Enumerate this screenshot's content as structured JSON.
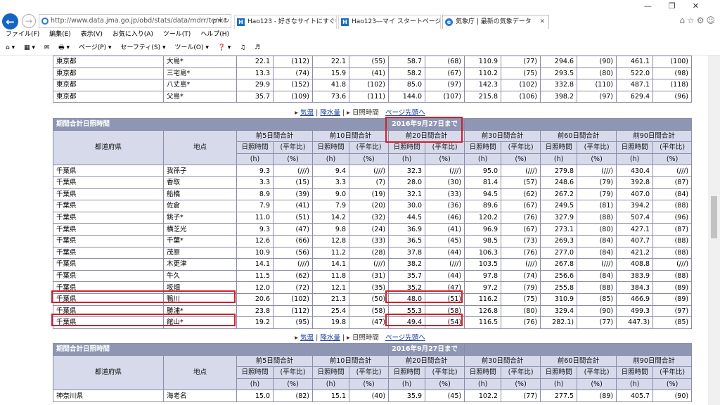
{
  "browser": {
    "url": "http://www.data.jma.go.jp/obd/stats/data/mdrr/tenkc",
    "addr_tools": "ρ ▾ ↻",
    "tabs": [
      {
        "label": "Hao123 - 好きなサイトにすぐ行ける",
        "icon": "H"
      },
      {
        "label": "Hao123―マイ スタートページ",
        "icon": "H"
      },
      {
        "label": "気象庁 | 最新の気象データ",
        "icon": "e"
      }
    ],
    "window_controls": "—❐✕",
    "right_icons": "⌂☆⚙☺",
    "menu": [
      "ファイル(F)",
      "編集(E)",
      "表示(V)",
      "お気に入り(A)",
      "ツール(T)",
      "ヘルプ(H)"
    ],
    "commands": [
      "⌂ ▾",
      "▦ ▾",
      "✉",
      "🖶 ▾",
      "ページ(P) ▾",
      "セーフティ(S) ▾",
      "ツール(O) ▾",
      "❓ ▾",
      "♫",
      "♬"
    ]
  },
  "page": {
    "links": {
      "items": [
        "気温",
        "降水量",
        "日照時間",
        "ページ先頭へ"
      ],
      "sep": "|"
    },
    "top_rows": [
      [
        "東京都",
        "大島*",
        "22.1",
        "(112)",
        "22.1",
        "(55)",
        "58.7",
        "(68)",
        "110.9",
        "(77)",
        "294.6",
        "(90)",
        "461.1",
        "(100)"
      ],
      [
        "東京都",
        "三宅島*",
        "13.3",
        "(74)",
        "15.9",
        "(41)",
        "58.2",
        "(67)",
        "110.2",
        "(75)",
        "293.5",
        "(80)",
        "522.0",
        "(98)"
      ],
      [
        "東京都",
        "八丈島*",
        "29.9",
        "(152)",
        "41.8",
        "(102)",
        "85.0",
        "(97)",
        "142.3",
        "(102)",
        "332.8",
        "(110)",
        "487.1",
        "(118)"
      ],
      [
        "東京都",
        "父島*",
        "35.7",
        "(109)",
        "73.6",
        "(111)",
        "144.0",
        "(107)",
        "215.8",
        "(106)",
        "398.2",
        "(97)",
        "629.4",
        "(96)"
      ]
    ],
    "section_title": "期間合計日照時間",
    "date_label": "2016年9月27日まで",
    "col_pref": "都道府県",
    "col_point": "地点",
    "periods": [
      "前5日間合計",
      "前10日間合計",
      "前20日間合計",
      "前30日間合計",
      "前60日間合計",
      "前90日間合計"
    ],
    "sub_hours": "日照時間",
    "sub_ratio": "(平年比)",
    "unit_hours": "(h)",
    "unit_ratio": "(%)",
    "chiba_rows": [
      [
        "千葉県",
        "我孫子",
        "9.3",
        "(///)",
        "9.4",
        "(///)",
        "32.3",
        "(///)",
        "95.0",
        "(///)",
        "279.8",
        "(///)",
        "430.4",
        "(///)"
      ],
      [
        "千葉県",
        "香取",
        "3.3",
        "(15)",
        "3.3",
        "(7)",
        "28.0",
        "(30)",
        "81.4",
        "(57)",
        "248.6",
        "(79)",
        "392.8",
        "(87)"
      ],
      [
        "千葉県",
        "船橋",
        "8.9",
        "(39)",
        "9.0",
        "(19)",
        "32.1",
        "(33)",
        "94.5",
        "(62)",
        "267.2",
        "(79)",
        "407.0",
        "(84)"
      ],
      [
        "千葉県",
        "佐倉",
        "7.9",
        "(41)",
        "7.9",
        "(20)",
        "30.0",
        "(36)",
        "89.6",
        "(67)",
        "249.5",
        "(81)",
        "394.2",
        "(88)"
      ],
      [
        "千葉県",
        "銚子*",
        "11.0",
        "(51)",
        "14.2",
        "(32)",
        "44.5",
        "(46)",
        "120.2",
        "(76)",
        "327.9",
        "(88)",
        "507.4",
        "(96)"
      ],
      [
        "千葉県",
        "横芝光",
        "9.3",
        "(47)",
        "9.8",
        "(24)",
        "36.9",
        "(41)",
        "96.9",
        "(67)",
        "273.1",
        "(80)",
        "427.1",
        "(87)"
      ],
      [
        "千葉県",
        "千葉*",
        "12.6",
        "(66)",
        "12.8",
        "(33)",
        "36.5",
        "(45)",
        "98.5",
        "(73)",
        "269.3",
        "(84)",
        "407.7",
        "(88)"
      ],
      [
        "千葉県",
        "茂原",
        "10.9",
        "(56)",
        "11.2",
        "(28)",
        "37.8",
        "(44)",
        "106.3",
        "(76)",
        "277.0",
        "(84)",
        "421.2",
        "(88)"
      ],
      [
        "千葉県",
        "木更津",
        "14.1",
        "(///)",
        "14.1",
        "(///)",
        "38.2",
        "(///)",
        "103.5",
        "(///)",
        "267.8",
        "(///)",
        "408.8",
        "(///)"
      ],
      [
        "千葉県",
        "牛久",
        "11.5",
        "(62)",
        "11.8",
        "(31)",
        "35.7",
        "(44)",
        "97.8",
        "(74)",
        "256.6",
        "(84)",
        "383.9",
        "(88)"
      ],
      [
        "千葉県",
        "坂畑",
        "12.0",
        "(72)",
        "12.1",
        "(35)",
        "35.2",
        "(47)",
        "97.2",
        "(79)",
        "255.8",
        "(88)",
        "384.3",
        "(89)"
      ],
      [
        "千葉県",
        "鴨川",
        "20.6",
        "(102)",
        "21.3",
        "(50)",
        "48.0",
        "(51)",
        "116.2",
        "(75)",
        "310.9",
        "(85)",
        "466.9",
        "(89)"
      ],
      [
        "千葉県",
        "勝浦*",
        "23.8",
        "(112)",
        "25.4",
        "(58)",
        "55.3",
        "(58)",
        "126.8",
        "(80)",
        "329.4",
        "(90)",
        "499.3",
        "(97)"
      ],
      [
        "千葉県",
        "館山*",
        "19.2",
        "(95)",
        "19.8",
        "(47)",
        "49.4",
        "(54)",
        "116.5",
        "(76)",
        "282.1)",
        "(77)",
        "447.3)",
        "(85)"
      ]
    ],
    "kanagawa_rows": [
      [
        "神奈川県",
        "海老名",
        "15.0",
        "(82)",
        "15.1",
        "(40)",
        "35.9",
        "(45)",
        "102.2",
        "(77)",
        "277.5",
        "(89)",
        "405.7",
        "(90)"
      ]
    ]
  }
}
